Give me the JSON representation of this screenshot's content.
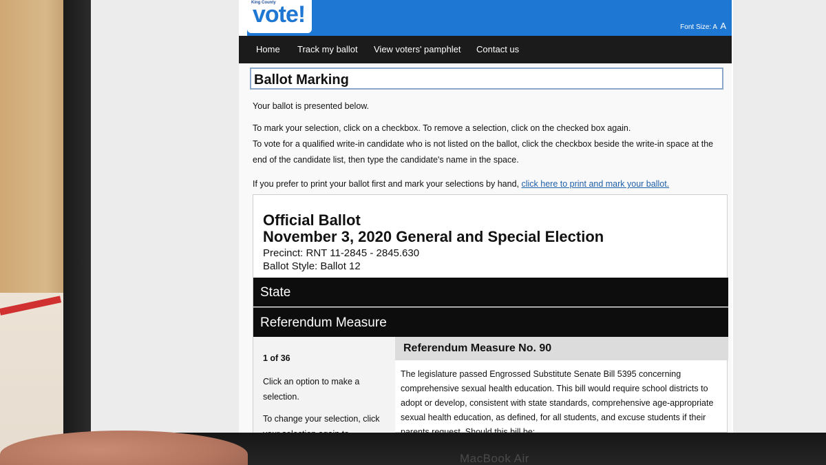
{
  "device": {
    "label": "MacBook Air"
  },
  "header": {
    "logo_small": "King County",
    "logo_main": "vote!",
    "font_size_label": "Font Size:",
    "font_size_small": "A",
    "font_size_large": "A"
  },
  "nav": {
    "items": [
      "Home",
      "Track my ballot",
      "View voters' pamphlet",
      "Contact us"
    ]
  },
  "page": {
    "title": "Ballot Marking",
    "intro": "Your ballot is presented below.",
    "instruction_mark": "To mark your selection, click on a checkbox. To remove a selection, click on the checked box again.",
    "instruction_writein": "To vote for a qualified write-in candidate who is not listed on the ballot, click the checkbox beside the write-in space at the end of the candidate list, then type the candidate's name in the space.",
    "print_prefix": "If you prefer to print your ballot first and mark your selections by hand,",
    "print_link": "click here to print and mark your ballot."
  },
  "ballot": {
    "heading": "Official Ballot",
    "election": "November 3, 2020 General and Special Election",
    "precinct": "Precinct: RNT 11-2845 - 2845.630",
    "style": "Ballot Style: Ballot 12",
    "section": "State",
    "subsection": "Referendum Measure",
    "counter": "1 of 36",
    "help_select": "Click an option to make a selection.",
    "help_change": "To change your selection, click your selection again to",
    "measure_title": "Referendum Measure No. 90",
    "measure_text": "The legislature passed Engrossed Substitute Senate Bill 5395 concerning comprehensive sexual health education. This bill would require school districts to adopt or develop, consistent with state standards, comprehensive age-appropriate sexual health education, as defined, for all students, and excuse students if their parents request. Should this bill be:"
  },
  "colors": {
    "header_blue": "#1f77d4",
    "nav_black": "#1b1b1b",
    "link_blue": "#1f5fa8",
    "band_black": "#0d0d0d"
  }
}
